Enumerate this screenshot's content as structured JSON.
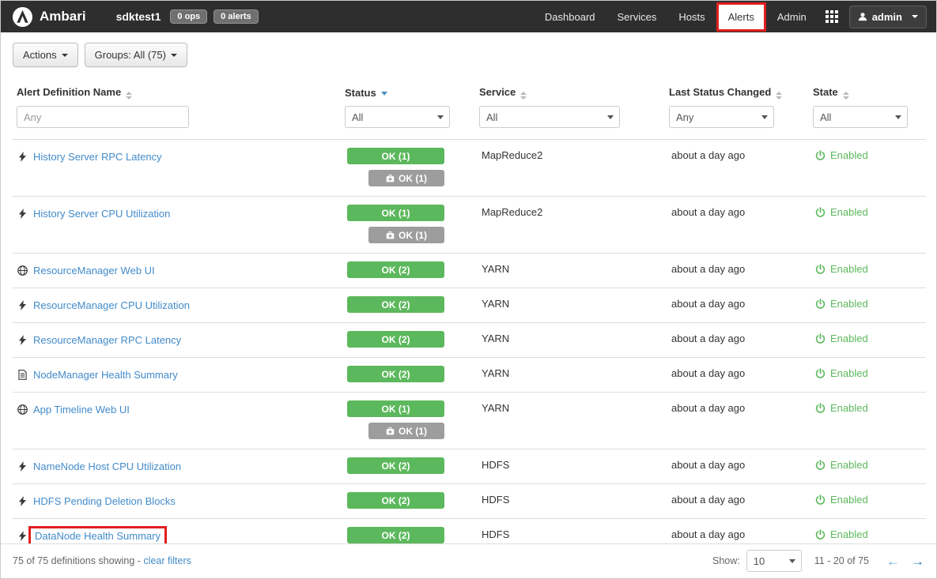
{
  "navbar": {
    "brand": "Ambari",
    "cluster_name": "sdktest1",
    "ops_badge": "0 ops",
    "alerts_badge": "0 alerts",
    "items": [
      {
        "label": "Dashboard",
        "active": false
      },
      {
        "label": "Services",
        "active": false
      },
      {
        "label": "Hosts",
        "active": false
      },
      {
        "label": "Alerts",
        "active": true,
        "annotated": true
      },
      {
        "label": "Admin",
        "active": false
      }
    ],
    "user_label": "admin"
  },
  "toolbar": {
    "actions_label": "Actions",
    "groups_label": "Groups:  All (75)"
  },
  "table": {
    "headers": {
      "name": "Alert Definition Name",
      "status": "Status",
      "service": "Service",
      "last_changed": "Last Status Changed",
      "state": "State"
    },
    "sorted_column": "Status",
    "filters": {
      "name_placeholder": "Any",
      "status": "All",
      "service": "All",
      "last_changed": "Any",
      "state": "All"
    },
    "rows": [
      {
        "icon": "bolt",
        "name": "History Server RPC Latency",
        "badges": [
          {
            "type": "ok",
            "label": "OK (1)"
          },
          {
            "type": "maint",
            "label": "OK (1)"
          }
        ],
        "service": "MapReduce2",
        "last_changed": "about a day ago",
        "state": "Enabled",
        "annotated": false
      },
      {
        "icon": "bolt",
        "name": "History Server CPU Utilization",
        "badges": [
          {
            "type": "ok",
            "label": "OK (1)"
          },
          {
            "type": "maint",
            "label": "OK (1)"
          }
        ],
        "service": "MapReduce2",
        "last_changed": "about a day ago",
        "state": "Enabled",
        "annotated": false
      },
      {
        "icon": "globe",
        "name": "ResourceManager Web UI",
        "badges": [
          {
            "type": "ok",
            "label": "OK (2)"
          }
        ],
        "service": "YARN",
        "last_changed": "about a day ago",
        "state": "Enabled",
        "annotated": false
      },
      {
        "icon": "bolt",
        "name": "ResourceManager CPU Utilization",
        "badges": [
          {
            "type": "ok",
            "label": "OK (2)"
          }
        ],
        "service": "YARN",
        "last_changed": "about a day ago",
        "state": "Enabled",
        "annotated": false
      },
      {
        "icon": "bolt",
        "name": "ResourceManager RPC Latency",
        "badges": [
          {
            "type": "ok",
            "label": "OK (2)"
          }
        ],
        "service": "YARN",
        "last_changed": "about a day ago",
        "state": "Enabled",
        "annotated": false
      },
      {
        "icon": "document",
        "name": "NodeManager Health Summary",
        "badges": [
          {
            "type": "ok",
            "label": "OK (2)"
          }
        ],
        "service": "YARN",
        "last_changed": "about a day ago",
        "state": "Enabled",
        "annotated": false
      },
      {
        "icon": "globe",
        "name": "App Timeline Web UI",
        "badges": [
          {
            "type": "ok",
            "label": "OK (1)"
          },
          {
            "type": "maint",
            "label": "OK (1)"
          }
        ],
        "service": "YARN",
        "last_changed": "about a day ago",
        "state": "Enabled",
        "annotated": false
      },
      {
        "icon": "bolt",
        "name": "NameNode Host CPU Utilization",
        "badges": [
          {
            "type": "ok",
            "label": "OK (2)"
          }
        ],
        "service": "HDFS",
        "last_changed": "about a day ago",
        "state": "Enabled",
        "annotated": false
      },
      {
        "icon": "bolt",
        "name": "HDFS Pending Deletion Blocks",
        "badges": [
          {
            "type": "ok",
            "label": "OK (2)"
          }
        ],
        "service": "HDFS",
        "last_changed": "about a day ago",
        "state": "Enabled",
        "annotated": false
      },
      {
        "icon": "bolt",
        "name": "DataNode Health Summary",
        "badges": [
          {
            "type": "ok",
            "label": "OK (2)"
          }
        ],
        "service": "HDFS",
        "last_changed": "about a day ago",
        "state": "Enabled",
        "annotated": true
      }
    ]
  },
  "footer": {
    "summary": "75 of 75 definitions showing",
    "dash": "-",
    "clear_filters": "clear filters",
    "show_label": "Show:",
    "page_size": "10",
    "range_text": "11 - 20 of 75"
  },
  "icons": {
    "row_type_icons": [
      "bolt",
      "globe",
      "document"
    ],
    "state_icon": "power",
    "maintenance_icon": "medkit"
  },
  "colors": {
    "ok_badge": "#5cb85c",
    "maintenance_badge": "#9d9d9d",
    "link": "#428bca",
    "enabled_text": "#5cb85c",
    "navbar_bg": "#2f2e2e",
    "annotation_red": "#e01f1f"
  }
}
